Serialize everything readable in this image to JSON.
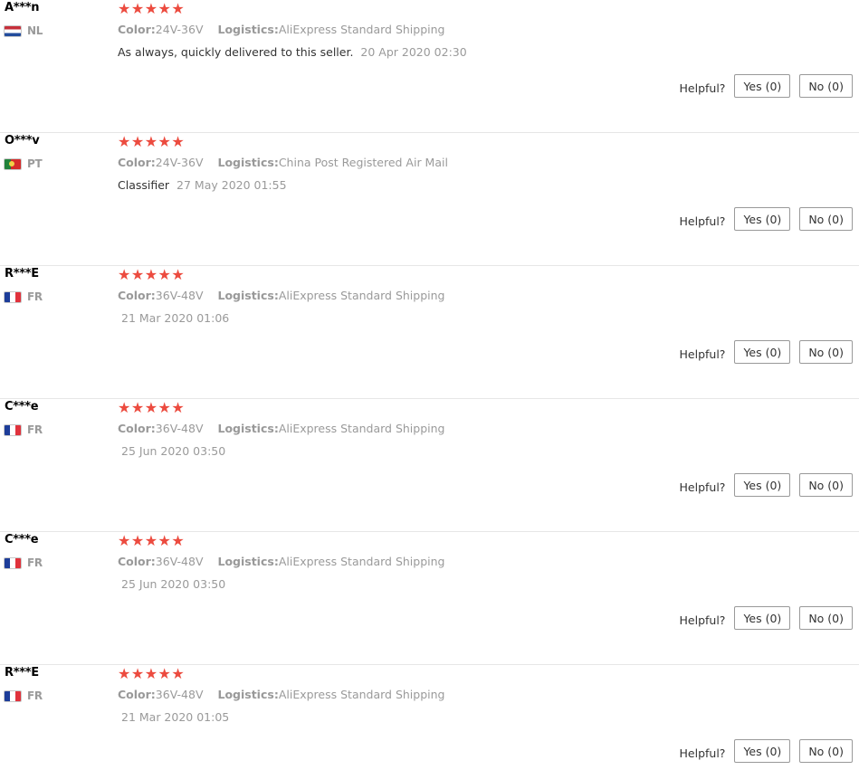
{
  "labels": {
    "color": "Color:",
    "logistics": "Logistics:",
    "helpful": "Helpful?"
  },
  "star_color": "#ec4b3f",
  "reviews": [
    {
      "user": "A***n",
      "country": "NL",
      "rating": 5,
      "stars": "★★★★★",
      "color": "24V-36V",
      "logistics": "AliExpress Standard Shipping",
      "feedback": "As always, quickly delivered to this seller.",
      "date": "20 Apr 2020 02:30",
      "yes": "Yes (0)",
      "no": "No (0)"
    },
    {
      "user": "O***v",
      "country": "PT",
      "rating": 5,
      "stars": "★★★★★",
      "color": "24V-36V",
      "logistics": "China Post Registered Air Mail",
      "feedback": "Classifier",
      "date": "27 May 2020 01:55",
      "yes": "Yes (0)",
      "no": "No (0)"
    },
    {
      "user": "R***E",
      "country": "FR",
      "rating": 5,
      "stars": "★★★★★",
      "color": "36V-48V",
      "logistics": "AliExpress Standard Shipping",
      "feedback": "",
      "date": "21 Mar 2020 01:06",
      "yes": "Yes (0)",
      "no": "No (0)"
    },
    {
      "user": "C***e",
      "country": "FR",
      "rating": 5,
      "stars": "★★★★★",
      "color": "36V-48V",
      "logistics": "AliExpress Standard Shipping",
      "feedback": "",
      "date": "25 Jun 2020 03:50",
      "yes": "Yes (0)",
      "no": "No (0)"
    },
    {
      "user": "C***e",
      "country": "FR",
      "rating": 5,
      "stars": "★★★★★",
      "color": "36V-48V",
      "logistics": "AliExpress Standard Shipping",
      "feedback": "",
      "date": "25 Jun 2020 03:50",
      "yes": "Yes (0)",
      "no": "No (0)"
    },
    {
      "user": "R***E",
      "country": "FR",
      "rating": 5,
      "stars": "★★★★★",
      "color": "36V-48V",
      "logistics": "AliExpress Standard Shipping",
      "feedback": "",
      "date": "21 Mar 2020 01:05",
      "yes": "Yes (0)",
      "no": "No (0)"
    }
  ]
}
